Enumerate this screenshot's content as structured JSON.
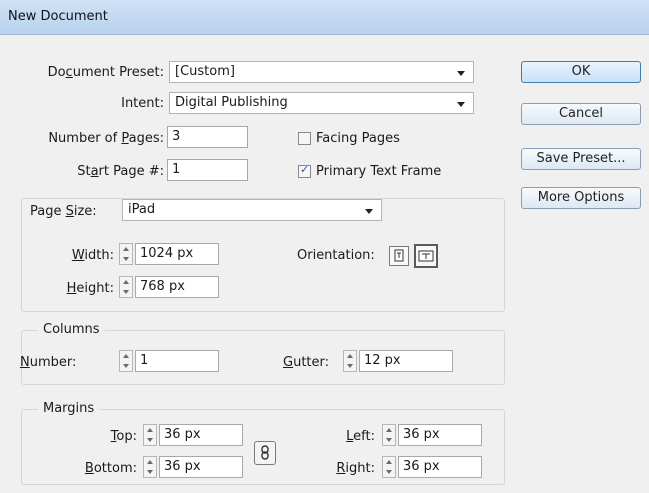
{
  "window": {
    "title": "New Document"
  },
  "document_preset": {
    "label": "Document Preset:",
    "value": "[Custom]"
  },
  "intent": {
    "label": "Intent:",
    "value": "Digital Publishing"
  },
  "number_of_pages": {
    "label": "Number of Pages:",
    "value": "3"
  },
  "start_page": {
    "label": "Start Page #:",
    "value": "1"
  },
  "facing_pages": {
    "label": "Facing Pages",
    "checked": false
  },
  "primary_text_frame": {
    "label": "Primary Text Frame",
    "checked": true
  },
  "buttons": {
    "ok": "OK",
    "cancel": "Cancel",
    "save_preset": "Save Preset...",
    "more_options": "More Options"
  },
  "page_size": {
    "label": "Page Size:",
    "value": "iPad",
    "width_label": "Width:",
    "width": "1024 px",
    "height_label": "Height:",
    "height": "768 px",
    "orientation_label": "Orientation:",
    "orientation_selected": "landscape"
  },
  "columns": {
    "legend": "Columns",
    "number_label": "Number:",
    "number": "1",
    "gutter_label": "Gutter:",
    "gutter": "12 px"
  },
  "margins": {
    "legend": "Margins",
    "top_label": "Top:",
    "top": "36 px",
    "bottom_label": "Bottom:",
    "bottom": "36 px",
    "left_label": "Left:",
    "left": "36 px",
    "right_label": "Right:",
    "right": "36 px",
    "link_icon": "chain-link-icon"
  }
}
